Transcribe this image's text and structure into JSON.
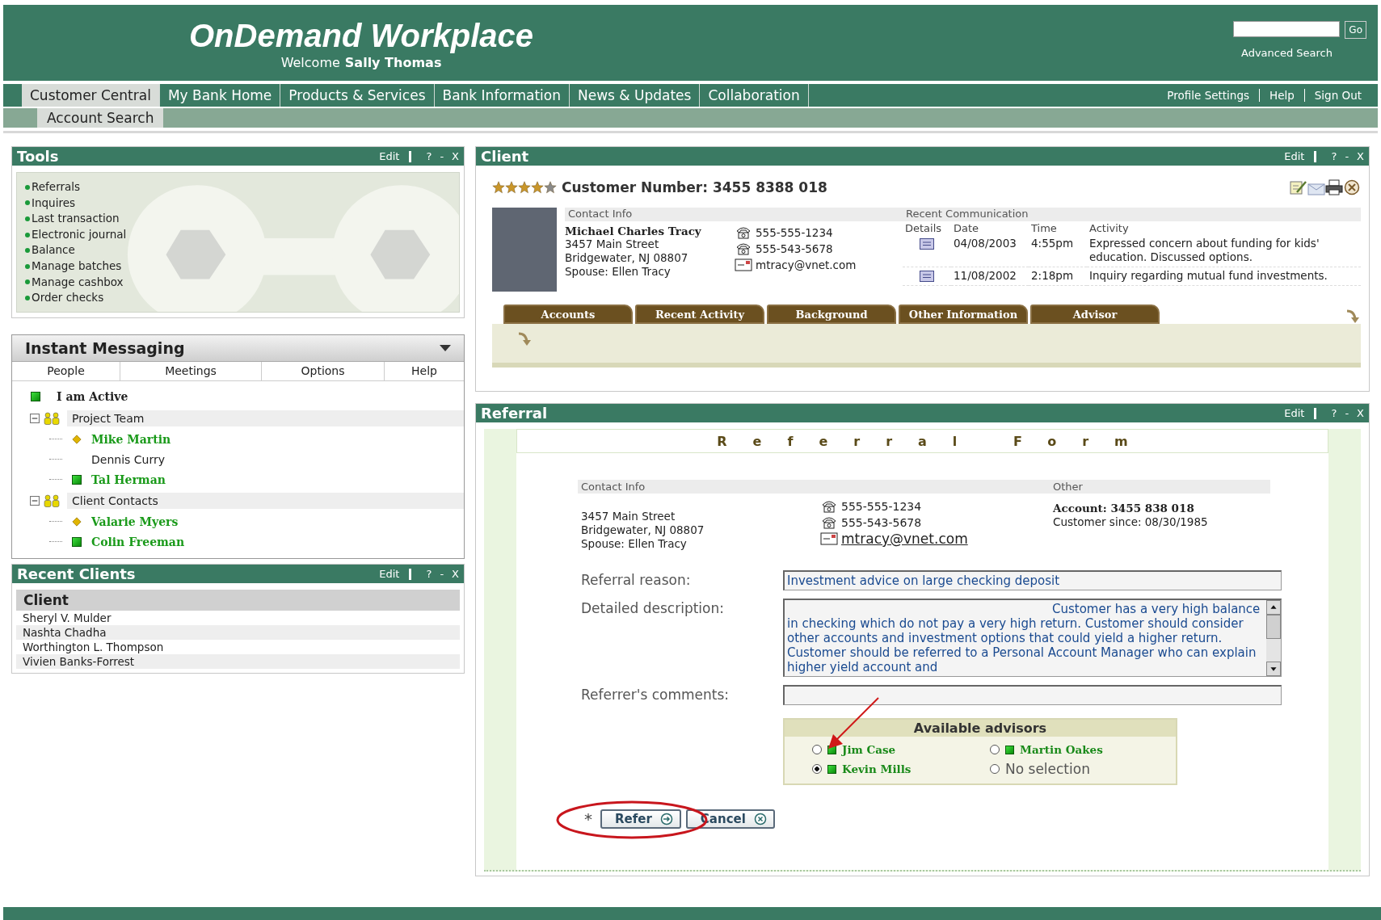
{
  "header": {
    "title": "OnDemand Workplace",
    "welcome": "Welcome",
    "user": "Sally Thomas",
    "search_button": "Go",
    "advanced_search": "Advanced Search"
  },
  "nav": {
    "tabs": [
      {
        "label": "Customer Central",
        "selected": true
      },
      {
        "label": "My Bank Home",
        "selected": false
      },
      {
        "label": "Products & Services",
        "selected": false
      },
      {
        "label": "Bank Information",
        "selected": false
      },
      {
        "label": "News & Updates",
        "selected": false
      },
      {
        "label": "Collaboration",
        "selected": false
      }
    ],
    "links": [
      "Profile Settings",
      "Help",
      "Sign Out"
    ],
    "subtabs": [
      {
        "label": "Account Search",
        "selected": true
      }
    ]
  },
  "tools": {
    "title": "Tools",
    "controls": [
      "Edit",
      "?",
      "-",
      "X"
    ],
    "items": [
      "Referrals",
      "Inquires",
      "Last transaction",
      "Electronic journal",
      "Balance",
      "Manage batches",
      "Manage cashbox",
      "Order checks"
    ]
  },
  "instant_messaging": {
    "title": "Instant Messaging",
    "menu": [
      "People",
      "Meetings",
      "Options",
      "Help"
    ],
    "self": {
      "name": "I am Active",
      "kind": "online"
    },
    "groups": [
      {
        "name": "Project Team",
        "expanded": true,
        "children": [
          {
            "name": "Mike Martin",
            "kind": "away"
          },
          {
            "name": "Dennis Curry",
            "kind": "offline"
          },
          {
            "name": "Tal Herman",
            "kind": "online"
          }
        ]
      },
      {
        "name": "Client Contacts",
        "expanded": true,
        "children": [
          {
            "name": "Valarie Myers",
            "kind": "away"
          },
          {
            "name": "Colin Freeman",
            "kind": "online"
          }
        ]
      }
    ]
  },
  "recent_clients": {
    "title": "Recent Clients",
    "controls": [
      "Edit",
      "?",
      "-",
      "X"
    ],
    "column": "Client",
    "rows": [
      "Sheryl V. Mulder",
      "Nashta Chadha",
      "Worthington L. Thompson",
      "Vivien Banks-Forrest"
    ]
  },
  "client": {
    "title": "Client",
    "controls": [
      "Edit",
      "?",
      "-",
      "X"
    ],
    "stars": 4,
    "customer_number": "Customer Number: 3455 8388 018",
    "contact_heading": "Contact Info",
    "name": "Michael Charles Tracy",
    "address": [
      "3457 Main Street",
      "Bridgewater, NJ 08807",
      "Spouse: Ellen Tracy"
    ],
    "phones": [
      "555-555-1234",
      "555-543-5678"
    ],
    "email": "mtracy@vnet.com",
    "communication": {
      "heading": "Recent Communication",
      "columns": [
        "Details",
        "Date",
        "Time",
        "Activity"
      ],
      "rows": [
        {
          "date": "04/08/2003",
          "time": "4:55pm",
          "activity": "Expressed concern about funding for kids' education. Discussed options."
        },
        {
          "date": "11/08/2002",
          "time": "2:18pm",
          "activity": "Inquiry regarding mutual fund investments."
        }
      ]
    },
    "tabs": [
      {
        "label": "Accounts",
        "selected": false
      },
      {
        "label": "Recent Activity",
        "selected": false
      },
      {
        "label": "Background",
        "selected": false
      },
      {
        "label": "Other Information",
        "selected": false
      },
      {
        "label": "Advisor",
        "selected": false
      }
    ]
  },
  "referral": {
    "title": "Referral",
    "controls": [
      "Edit",
      "?",
      "-",
      "X"
    ],
    "form_title": "Referral Form",
    "contact_heading": "Contact Info",
    "other_heading": "Other",
    "address": [
      "3457 Main Street",
      "Bridgewater, NJ 08807",
      "Spouse: Ellen Tracy"
    ],
    "phones": [
      "555-555-1234",
      "555-543-5678"
    ],
    "email": "mtracy@vnet.com",
    "account": "Account: 3455 838 018",
    "customer_since": "Customer since: 08/30/1985",
    "fields": [
      {
        "kind": "line",
        "label": "Referral reason:",
        "value": "Investment advice on large checking deposit"
      },
      {
        "kind": "multiline",
        "label": "Detailed description:",
        "value": "Customer has a very high balance in checking which do not pay a very high return. Customer should consider other accounts and investment options that could yield a higher return.   Customer should be referred to a Personal Account Manager who can explain higher yield account and"
      },
      {
        "kind": "line",
        "label": "Referrer's comments:"
      }
    ],
    "advisors": {
      "title": "Available advisors",
      "options": [
        {
          "kind": "advisor",
          "name": "Jim Case",
          "selected": false,
          "online": true
        },
        {
          "kind": "advisor",
          "name": "Martin Oakes",
          "selected": false,
          "online": true
        },
        {
          "kind": "advisor",
          "name": "Kevin Mills",
          "selected": true,
          "online": true
        },
        {
          "kind": "none",
          "name": "No selection",
          "selected": false
        }
      ]
    },
    "required_mark": "*",
    "buttons": [
      {
        "kind": "refer",
        "label": "Refer"
      },
      {
        "kind": "cancel",
        "label": "Cancel"
      }
    ]
  }
}
